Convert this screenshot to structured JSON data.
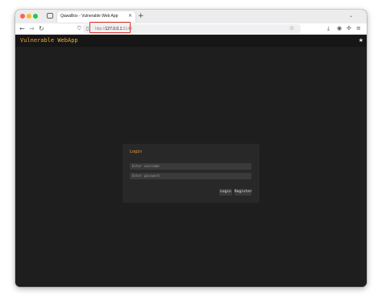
{
  "browser": {
    "tab": {
      "title": "QawaBox - Vulnerable Web App",
      "close_symbol": "×"
    },
    "new_tab_symbol": "+",
    "url": {
      "protocol": "http://",
      "host": "127.0.0.1",
      "port": ":5143"
    },
    "icons": {
      "back": "←",
      "forward": "→",
      "reload": "↻",
      "tab_list": "⌄",
      "bookmark": "☆",
      "download": "⤓",
      "account": "◉",
      "extensions": "✣",
      "menu": "≡",
      "shield": "⛉",
      "page": "▯"
    },
    "colors": {
      "highlight": "#e0302a"
    }
  },
  "app": {
    "title": "Vulnerable WebApp",
    "star_icon": "★",
    "accent_color": "#f2a83b"
  },
  "login": {
    "title": "Login",
    "username_placeholder": "Enter username",
    "password_placeholder": "Enter password",
    "login_label": "Login",
    "register_label": "Register"
  }
}
